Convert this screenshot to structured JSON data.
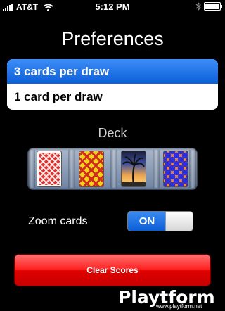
{
  "status_bar": {
    "carrier": "AT&T",
    "time": "5:12 PM",
    "battery_level": 0.85
  },
  "title": "Preferences",
  "draw_options": [
    {
      "label": "3 cards per draw",
      "selected": true
    },
    {
      "label": "1 card per draw",
      "selected": false
    }
  ],
  "deck": {
    "label": "Deck",
    "cards": [
      {
        "name": "red-lattice-card"
      },
      {
        "name": "yellow-red-lattice-card"
      },
      {
        "name": "palm-tree-sunset-card"
      },
      {
        "name": "orange-blue-dots-card"
      }
    ]
  },
  "zoom": {
    "label": "Zoom cards",
    "state": "ON"
  },
  "clear_scores_label": "Clear Scores",
  "watermark": {
    "logo": "Playtform",
    "url": "www.playtform.net"
  },
  "colors": {
    "selected_blue": "#1a6ce6",
    "clear_red": "#ff1d1d"
  }
}
